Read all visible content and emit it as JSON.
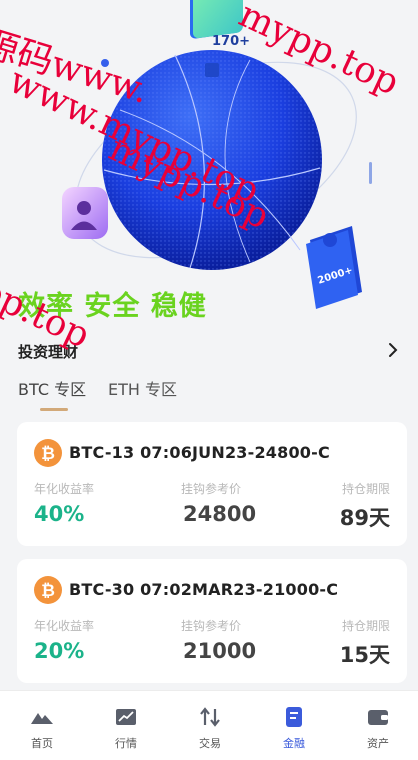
{
  "hero": {
    "bubble_value": "170+",
    "badge_value": "2000+",
    "slogan": "效率 安全 稳健"
  },
  "section": {
    "title": "投资理财"
  },
  "tabs": [
    {
      "label": "BTC 专区",
      "active": true
    },
    {
      "label": "ETH 专区",
      "active": false
    }
  ],
  "cards": [
    {
      "coin": "bitcoin-icon",
      "title": "BTC-13 07:06JUN23-24800-C",
      "labels": [
        "年化收益率",
        "挂钩参考价",
        "持仓期限"
      ],
      "rate": "40%",
      "ref_price": "24800",
      "term": "89天"
    },
    {
      "coin": "bitcoin-icon",
      "title": "BTC-30 07:02MAR23-21000-C",
      "labels": [
        "年化收益率",
        "挂钩参考价",
        "持仓期限"
      ],
      "rate": "20%",
      "ref_price": "21000",
      "term": "15天"
    }
  ],
  "bottom_nav": [
    {
      "label": "首页",
      "icon": "home-icon"
    },
    {
      "label": "行情",
      "icon": "chart-icon"
    },
    {
      "label": "交易",
      "icon": "trade-icon"
    },
    {
      "label": "金融",
      "icon": "finance-icon",
      "active": true
    },
    {
      "label": "资产",
      "icon": "wallet-icon"
    }
  ],
  "colors": {
    "accent": "#3b5bdb",
    "slogan": "#6ad31f",
    "rate": "#1bb38a",
    "tab_underline": "#d2a979",
    "watermark": "#e8003a"
  },
  "watermarks": [
    "源码www.",
    "mypp.top",
    "www.mypp.top",
    "mypp.top",
    "pp.top"
  ]
}
